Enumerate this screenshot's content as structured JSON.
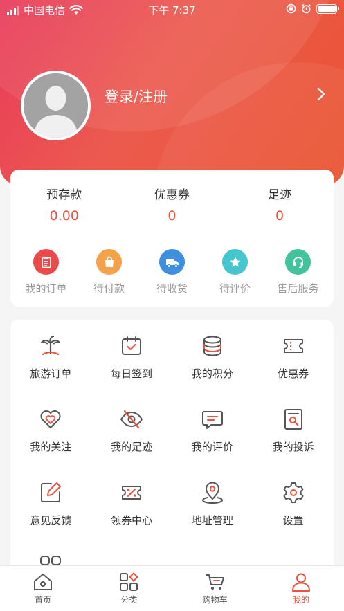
{
  "status_bar": {
    "carrier": "中国电信",
    "time": "下午 7:37",
    "battery_percent": 100
  },
  "profile": {
    "login_label": "登录/注册"
  },
  "stats": [
    {
      "label": "预存款",
      "value": "0.00"
    },
    {
      "label": "优惠券",
      "value": "0"
    },
    {
      "label": "足迹",
      "value": "0"
    }
  ],
  "orders": [
    {
      "label": "我的订单",
      "icon": "clipboard-icon",
      "color": "#e94b4b"
    },
    {
      "label": "待付款",
      "icon": "shopping-bag-icon",
      "color": "#f5a14a"
    },
    {
      "label": "待收货",
      "icon": "truck-icon",
      "color": "#3d8fe0"
    },
    {
      "label": "待评价",
      "icon": "star-icon",
      "color": "#45c6cf"
    },
    {
      "label": "售后服务",
      "icon": "headset-icon",
      "color": "#43c39c"
    }
  ],
  "services": [
    {
      "label": "旅游订单",
      "icon": "palm-tree-icon"
    },
    {
      "label": "每日签到",
      "icon": "calendar-check-icon"
    },
    {
      "label": "我的积分",
      "icon": "coin-stack-icon"
    },
    {
      "label": "优惠券",
      "icon": "ticket-icon"
    },
    {
      "label": "我的关注",
      "icon": "heart-icon"
    },
    {
      "label": "我的足迹",
      "icon": "eye-off-icon"
    },
    {
      "label": "我的评价",
      "icon": "comment-icon"
    },
    {
      "label": "我的投诉",
      "icon": "complaint-doc-icon"
    },
    {
      "label": "意见反馈",
      "icon": "edit-icon"
    },
    {
      "label": "领券中心",
      "icon": "percent-coupon-icon"
    },
    {
      "label": "地址管理",
      "icon": "location-pin-icon"
    },
    {
      "label": "设置",
      "icon": "gear-icon"
    }
  ],
  "tabs": [
    {
      "label": "首页",
      "icon": "home-icon",
      "active": false
    },
    {
      "label": "分类",
      "icon": "category-icon",
      "active": false
    },
    {
      "label": "购物车",
      "icon": "cart-icon",
      "active": false
    },
    {
      "label": "我的",
      "icon": "user-icon",
      "active": true
    }
  ],
  "colors": {
    "accent": "#e8533f",
    "icon_gray": "#555555"
  }
}
